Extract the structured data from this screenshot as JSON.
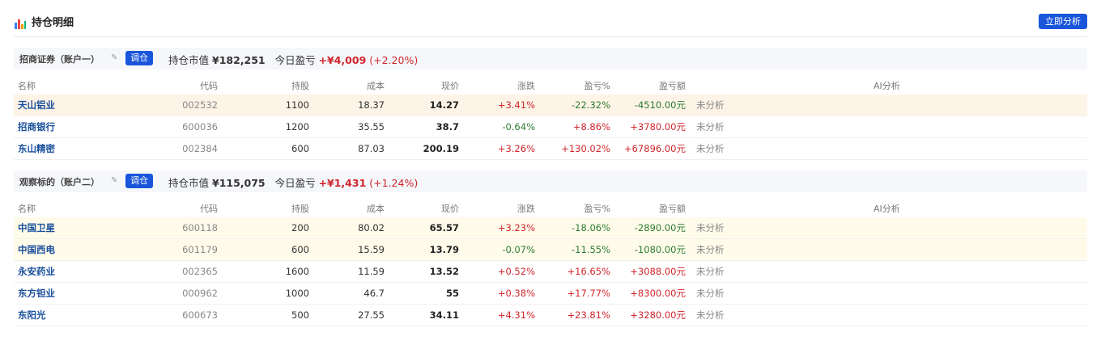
{
  "header": {
    "title": "持仓明细",
    "analyze_label": "立即分析"
  },
  "colors": {
    "accent": "#1a56db",
    "up": "#d0262d",
    "down": "#2e7d32"
  },
  "columns": {
    "name": "名称",
    "code": "代码",
    "shares": "持股",
    "cost": "成本",
    "price": "现价",
    "change": "涨跌",
    "pnl_pct": "盈亏%",
    "pnl_amt": "盈亏额",
    "ai": "AI分析"
  },
  "accounts": [
    {
      "name": "招商证券（账户一）",
      "adjust_label": "调仓",
      "market_value_label": "持仓市值",
      "market_value": "¥182,251",
      "today_pnl_label": "今日盈亏",
      "today_pnl": "+¥4,009",
      "today_pnl_pct": "(+2.20%)",
      "rows": [
        {
          "name": "天山铝业",
          "code": "002532",
          "shares": "1100",
          "cost": "18.37",
          "price": "14.27",
          "change": "+3.41%",
          "pnl_pct": "-22.32%",
          "pnl_amt": "-4510.00元",
          "ai": "未分析"
        },
        {
          "name": "招商银行",
          "code": "600036",
          "shares": "1200",
          "cost": "35.55",
          "price": "38.7",
          "change": "-0.64%",
          "pnl_pct": "+8.86%",
          "pnl_amt": "+3780.00元",
          "ai": "未分析"
        },
        {
          "name": "东山精密",
          "code": "002384",
          "shares": "600",
          "cost": "87.03",
          "price": "200.19",
          "change": "+3.26%",
          "pnl_pct": "+130.02%",
          "pnl_amt": "+67896.00元",
          "ai": "未分析"
        }
      ]
    },
    {
      "name": "观察标的（账户二）",
      "adjust_label": "调仓",
      "market_value_label": "持仓市值",
      "market_value": "¥115,075",
      "today_pnl_label": "今日盈亏",
      "today_pnl": "+¥1,431",
      "today_pnl_pct": "(+1.24%)",
      "rows": [
        {
          "name": "中国卫星",
          "code": "600118",
          "shares": "200",
          "cost": "80.02",
          "price": "65.57",
          "change": "+3.23%",
          "pnl_pct": "-18.06%",
          "pnl_amt": "-2890.00元",
          "ai": "未分析"
        },
        {
          "name": "中国西电",
          "code": "601179",
          "shares": "600",
          "cost": "15.59",
          "price": "13.79",
          "change": "-0.07%",
          "pnl_pct": "-11.55%",
          "pnl_amt": "-1080.00元",
          "ai": "未分析"
        },
        {
          "name": "永安药业",
          "code": "002365",
          "shares": "1600",
          "cost": "11.59",
          "price": "13.52",
          "change": "+0.52%",
          "pnl_pct": "+16.65%",
          "pnl_amt": "+3088.00元",
          "ai": "未分析"
        },
        {
          "name": "东方钽业",
          "code": "000962",
          "shares": "1000",
          "cost": "46.7",
          "price": "55",
          "change": "+0.38%",
          "pnl_pct": "+17.77%",
          "pnl_amt": "+8300.00元",
          "ai": "未分析"
        },
        {
          "name": "东阳光",
          "code": "600673",
          "shares": "500",
          "cost": "27.55",
          "price": "34.11",
          "change": "+4.31%",
          "pnl_pct": "+23.81%",
          "pnl_amt": "+3280.00元",
          "ai": "未分析"
        }
      ]
    }
  ]
}
